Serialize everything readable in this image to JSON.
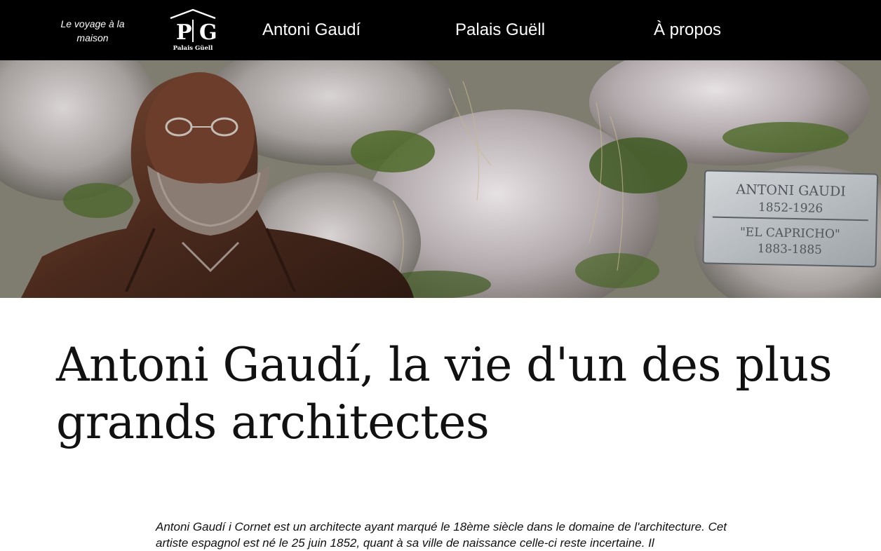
{
  "header": {
    "tagline": "Le voyage à la maison",
    "logo": {
      "letter_left": "P",
      "letter_right": "G",
      "caption": "Palais Güell"
    },
    "nav": [
      {
        "label": "Antoni Gaudí"
      },
      {
        "label": "Palais Guëll"
      },
      {
        "label": "À propos"
      }
    ]
  },
  "hero": {
    "plaque": {
      "line1": "ANTONI GAUDI",
      "line2": "1852-1926",
      "line3": "\"EL CAPRICHO\"",
      "line4": "1883-1885"
    }
  },
  "article": {
    "title": "Antoni Gaudí, la vie d'un des plus grands architectes",
    "intro": "Antoni Gaudí i Cornet est un architecte ayant marqué le 18ème siècle dans le domaine de l'architecture. Cet artiste espagnol est né le 25 juin 1852, quant à sa ville de naissance celle-ci reste incertaine. Il"
  },
  "colors": {
    "header_bg": "#000000",
    "header_text": "#ffffff",
    "body_bg": "#ffffff",
    "text": "#111111"
  }
}
